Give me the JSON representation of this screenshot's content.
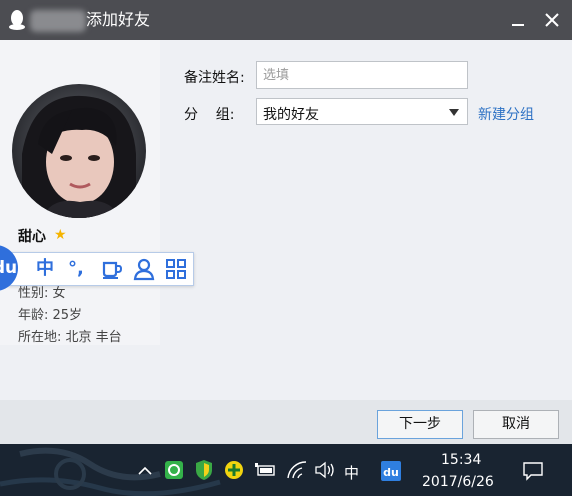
{
  "window": {
    "title": "添加好友",
    "minimize_symbol": "—",
    "close_symbol": "✕"
  },
  "profile": {
    "nickname": "甜心",
    "gender_line": "性别: 女",
    "age_line": "年龄: 25岁",
    "location_line": "所在地: 北京  丰台"
  },
  "ime_toolbar": {
    "logo": "du",
    "mode_label": "中",
    "punct_label": "°,",
    "icons": [
      "cup-icon",
      "person-icon",
      "grid-icon"
    ]
  },
  "form": {
    "remark_label": "备注姓名:",
    "remark_placeholder": "选填",
    "group_label": "分    组:",
    "group_value": "我的好友",
    "new_group_link": "新建分组"
  },
  "buttons": {
    "next": "下一步",
    "cancel": "取消"
  },
  "taskbar": {
    "ime_indicator": "中",
    "time": "15:34",
    "date": "2017/6/26",
    "tray_icons": [
      "chevron-up-icon",
      "app-green-icon",
      "shield-icon",
      "plus-icon",
      "battery-icon",
      "wifi-icon",
      "volume-icon",
      "baidu-ime-icon",
      "notification-icon"
    ]
  },
  "colors": {
    "titlebar": "#4c4d52",
    "link": "#2e72c4",
    "ime_blue": "#2f6fdc",
    "taskbar": "#192431"
  }
}
